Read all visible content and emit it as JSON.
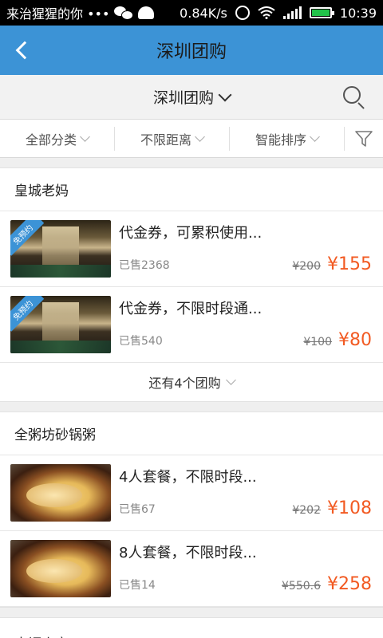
{
  "status_bar": {
    "notification_text": "来治猩猩的你 •••",
    "network_speed": "0.84K/s",
    "time": "10:39",
    "icons": [
      "wechat-icon",
      "android-icon",
      "alarm-icon",
      "wifi-icon",
      "signal-icon",
      "battery-icon"
    ]
  },
  "header": {
    "title": "深圳团购",
    "back_icon": "chevron-left-icon",
    "color": "#3c93d6"
  },
  "city_bar": {
    "city_label": "深圳团购",
    "search_icon": "search-icon"
  },
  "filters": [
    {
      "label": "全部分类"
    },
    {
      "label": "不限距离"
    },
    {
      "label": "智能排序"
    }
  ],
  "shops": [
    {
      "name": "皇城老妈",
      "deals": [
        {
          "badge": "免预约",
          "title": "代金券，可累积使用...",
          "sold": "已售2368",
          "original_price": "¥200",
          "price": "¥155"
        },
        {
          "badge": "免预约",
          "title": "代金券，不限时段通...",
          "sold": "已售540",
          "original_price": "¥100",
          "price": "¥80"
        }
      ],
      "more_label": "还有4个团购"
    },
    {
      "name": "全粥坊砂锅粥",
      "deals": [
        {
          "title": "4人套餐，不限时段...",
          "sold": "已售67",
          "original_price": "¥202",
          "price": "¥108"
        },
        {
          "title": "8人套餐，不限时段...",
          "sold": "已售14",
          "original_price": "¥550.6",
          "price": "¥258"
        }
      ]
    },
    {
      "name": "大福小宝"
    }
  ],
  "colors": {
    "accent": "#3c93d6",
    "price": "#f25a22"
  }
}
